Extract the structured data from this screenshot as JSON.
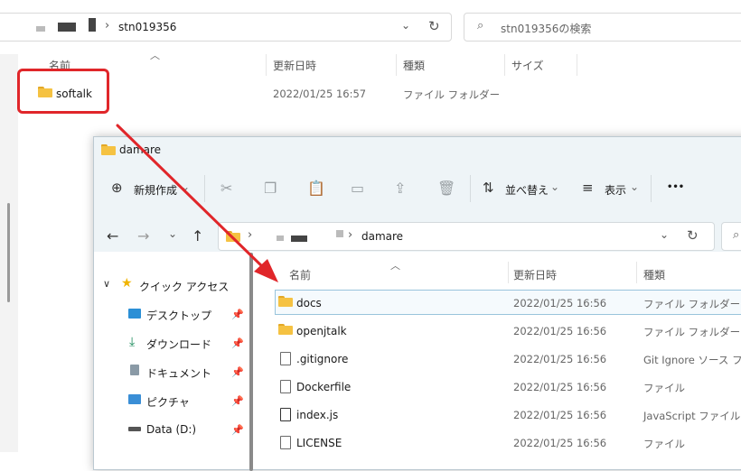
{
  "back_window": {
    "breadcrumb_sep": "›",
    "current_folder": "stn019356",
    "search_placeholder": "stn019356の検索",
    "columns": {
      "name": "名前",
      "modified": "更新日時",
      "type": "種類",
      "size": "サイズ"
    },
    "rows": [
      {
        "name": "softalk",
        "modified": "2022/01/25 16:57",
        "type": "ファイル フォルダー",
        "icon": "folder-icon"
      }
    ]
  },
  "front_window": {
    "title": "damare",
    "toolbar": {
      "new_label": "新規作成",
      "sort_label": "並べ替え",
      "view_label": "表示",
      "more_label": "•••"
    },
    "address": {
      "breadcrumb_sep": "›",
      "current_folder": "damare"
    },
    "columns": {
      "name": "名前",
      "modified": "更新日時",
      "type": "種類"
    },
    "nav": {
      "quick_access": "クイック アクセス",
      "items": [
        {
          "label": "デスクトップ",
          "icon": "desktop-icon"
        },
        {
          "label": "ダウンロード",
          "icon": "download-icon"
        },
        {
          "label": "ドキュメント",
          "icon": "documents-icon"
        },
        {
          "label": "ピクチャ",
          "icon": "pictures-icon"
        },
        {
          "label": "Data (D:)",
          "icon": "drive-icon"
        }
      ]
    },
    "rows": [
      {
        "name": "docs",
        "modified": "2022/01/25 16:56",
        "type": "ファイル フォルダー",
        "icon": "folder-icon"
      },
      {
        "name": "openjtalk",
        "modified": "2022/01/25 16:56",
        "type": "ファイル フォルダー",
        "icon": "folder-icon"
      },
      {
        "name": ".gitignore",
        "modified": "2022/01/25 16:56",
        "type": "Git Ignore ソース フ...",
        "icon": "gitignore-file-icon"
      },
      {
        "name": "Dockerfile",
        "modified": "2022/01/25 16:56",
        "type": "ファイル",
        "icon": "file-icon"
      },
      {
        "name": "index.js",
        "modified": "2022/01/25 16:56",
        "type": "JavaScript ファイル",
        "icon": "js-file-icon"
      },
      {
        "name": "LICENSE",
        "modified": "2022/01/25 16:56",
        "type": "ファイル",
        "icon": "file-icon"
      }
    ]
  },
  "colors": {
    "annotation_red": "#e0262a",
    "folder_yellow": "#f5c242",
    "window_chrome": "#eef4f7"
  }
}
